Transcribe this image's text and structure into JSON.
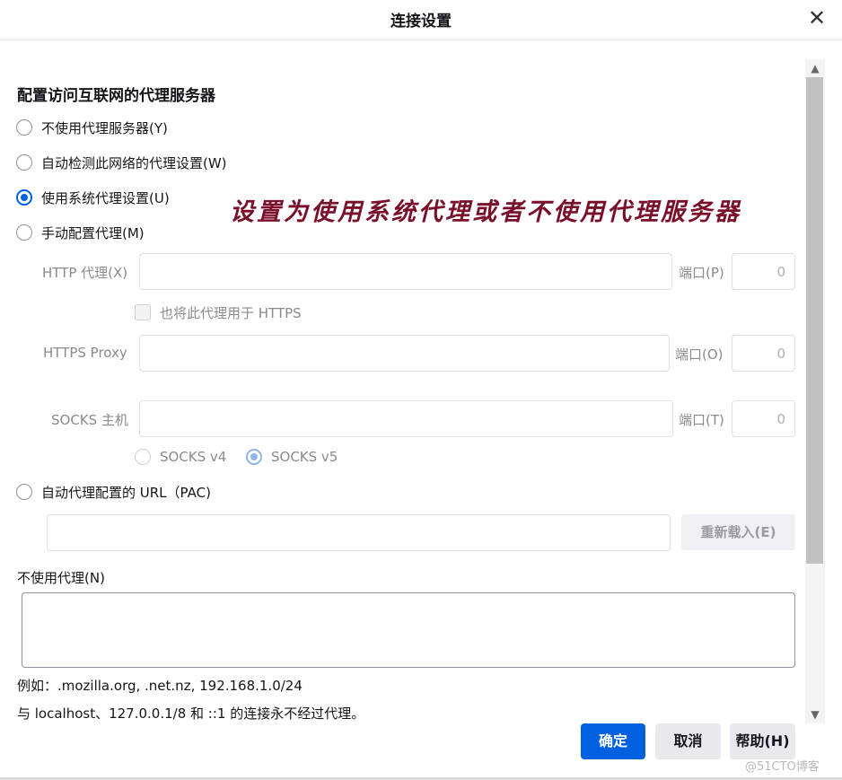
{
  "dialog": {
    "title": "连接设置",
    "close_icon": "close-icon"
  },
  "section": {
    "heading": "配置访问互联网的代理服务器",
    "options": [
      {
        "label": "不使用代理服务器(Y)",
        "checked": false
      },
      {
        "label": "自动检测此网络的代理设置(W)",
        "checked": false
      },
      {
        "label": "使用系统代理设置(U)",
        "checked": true
      },
      {
        "label": "手动配置代理(M)",
        "checked": false
      }
    ]
  },
  "annotation": "设置为使用系统代理或者不使用代理服务器",
  "manual": {
    "http_label": "HTTP 代理(X)",
    "http_value": "",
    "http_port_label": "端口(P)",
    "http_port": "0",
    "also_https_label": "也将此代理用于 HTTPS",
    "https_label": "HTTPS Proxy",
    "https_value": "",
    "https_port_label": "端口(O)",
    "https_port": "0",
    "socks_label": "SOCKS 主机",
    "socks_value": "",
    "socks_port_label": "端口(T)",
    "socks_port": "0",
    "socks_v4": "SOCKS v4",
    "socks_v5": "SOCKS v5"
  },
  "pac": {
    "label": "自动代理配置的 URL（PAC)",
    "value": "",
    "reload_button": "重新载入(E)"
  },
  "no_proxy": {
    "label": "不使用代理(N)",
    "value": "",
    "example": "例如：.mozilla.org, .net.nz, 192.168.1.0/24",
    "note": "与 localhost、127.0.0.1/8 和 ::1 的连接永不经过代理。"
  },
  "buttons": {
    "ok": "确定",
    "cancel": "取消",
    "help": "帮助(H)"
  },
  "watermark": "@51CTO博客",
  "colors": {
    "accent": "#0061e0",
    "annotation": "#7a0f2a"
  }
}
